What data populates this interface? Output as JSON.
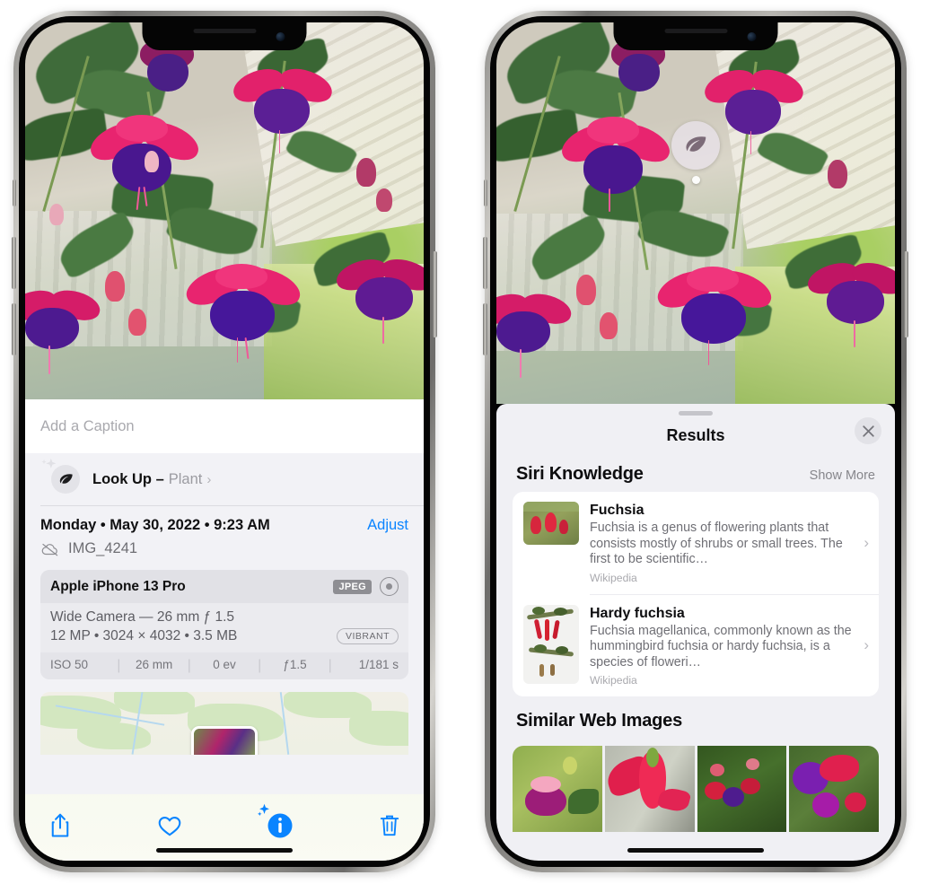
{
  "left_phone": {
    "caption": {
      "placeholder": "Add a Caption",
      "value": ""
    },
    "lookup": {
      "title": "Look Up –",
      "subject": "Plant",
      "chevron": "›",
      "icon": "leaf-icon",
      "sparkle_icon": "sparkle-icon"
    },
    "meta": {
      "date": "Monday • May 30, 2022 • 9:23 AM",
      "adjust_label": "Adjust",
      "filename": "IMG_4241",
      "cloud_icon": "cloud-slash-icon"
    },
    "camera": {
      "device": "Apple iPhone 13 Pro",
      "format_badge": "JPEG",
      "raw_icon": "raw-circle-icon",
      "lens_line": "Wide Camera — 26 mm ƒ 1.5",
      "specs_line": "12 MP • 3024 × 4032 • 3.5 MB",
      "style_badge": "VIBRANT",
      "exif": [
        "ISO 50",
        "26 mm",
        "0 ev",
        "ƒ1.5",
        "1/181 s"
      ]
    },
    "toolbar": [
      {
        "name": "share-icon",
        "label": "Share"
      },
      {
        "name": "heart-icon",
        "label": "Favorite"
      },
      {
        "name": "info-sparkle-icon",
        "label": "Info"
      },
      {
        "name": "trash-icon",
        "label": "Delete"
      }
    ],
    "map": {
      "pin_label": "photo-location-pin"
    }
  },
  "right_phone": {
    "badge": {
      "icon": "leaf-icon",
      "name": "visual-lookup-leaf-badge"
    },
    "sheet": {
      "title": "Results",
      "close_icon": "close-icon",
      "grabber": "drag-handle"
    },
    "siri_knowledge": {
      "heading": "Siri Knowledge",
      "action": "Show More",
      "items": [
        {
          "title": "Fuchsia",
          "description": "Fuchsia is a genus of flowering plants that consists mostly of shrubs or small trees. The first to be scientific…",
          "source": "Wikipedia",
          "chevron": "›"
        },
        {
          "title": "Hardy fuchsia",
          "description": "Fuchsia magellanica, commonly known as the hummingbird fuchsia or hardy fuchsia, is a species of floweri…",
          "source": "Wikipedia",
          "chevron": "›"
        }
      ]
    },
    "similar_web_images": {
      "heading": "Similar Web Images",
      "count": 4
    }
  },
  "colors": {
    "accent_blue": "#0a84ff",
    "sheet_bg": "#f2f2f6",
    "results_bg": "#f0f0f4",
    "card_white": "#ffffff",
    "secondary_text": "#6e6e73",
    "badge_gray": "#8e8e93"
  }
}
